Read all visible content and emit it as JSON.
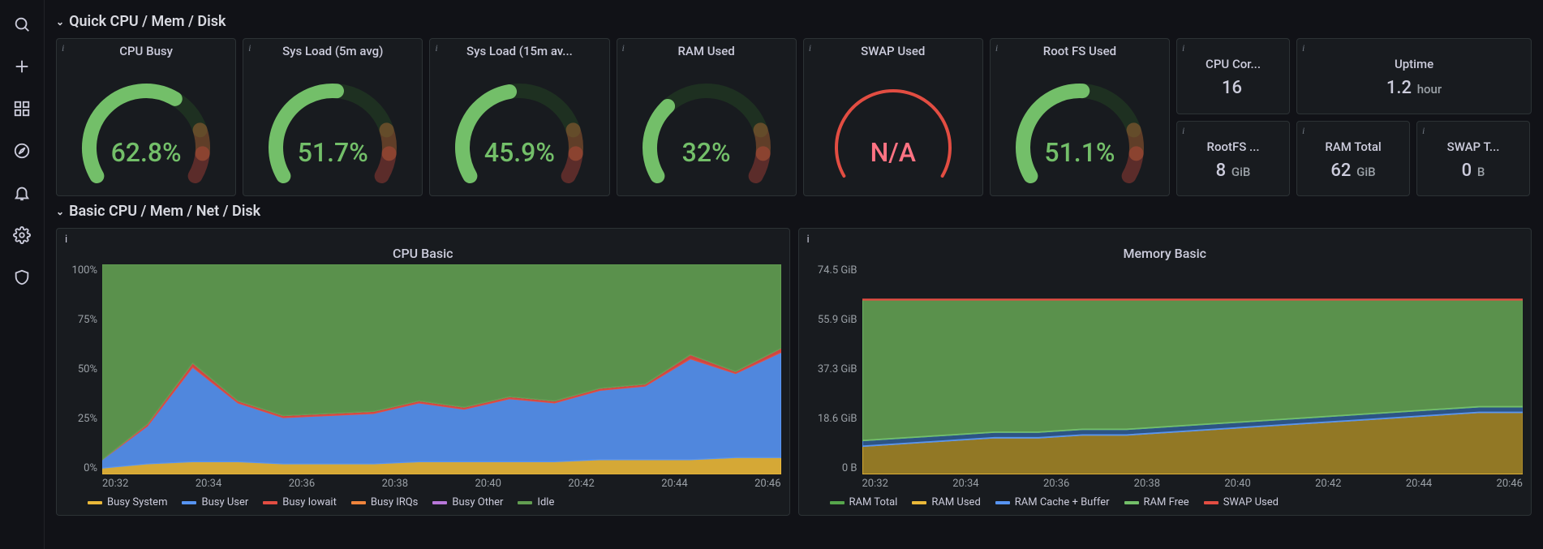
{
  "sidebar": {
    "items": [
      "search",
      "add",
      "dashboards",
      "explore",
      "alerting",
      "config",
      "admin"
    ]
  },
  "row1_title": "Quick CPU / Mem / Disk",
  "row2_title": "Basic CPU / Mem / Net / Disk",
  "gauges": [
    {
      "title": "CPU Busy",
      "value": 62.8,
      "display": "62.8%",
      "red": false
    },
    {
      "title": "Sys Load (5m avg)",
      "value": 51.7,
      "display": "51.7%",
      "red": false
    },
    {
      "title": "Sys Load (15m av...",
      "value": 45.9,
      "display": "45.9%",
      "red": false
    },
    {
      "title": "RAM Used",
      "value": 32,
      "display": "32%",
      "red": false
    },
    {
      "title": "SWAP Used",
      "value": null,
      "display": "N/A",
      "red": true
    },
    {
      "title": "Root FS Used",
      "value": 51.1,
      "display": "51.1%",
      "red": false
    }
  ],
  "stats_top": [
    {
      "title": "CPU Cor...",
      "value": "16",
      "unit": ""
    },
    {
      "title": "Uptime",
      "value": "1.2",
      "unit": "hour",
      "wide": true
    }
  ],
  "stats_bottom": [
    {
      "title": "RootFS ...",
      "value": "8",
      "unit": "GiB"
    },
    {
      "title": "RAM Total",
      "value": "62",
      "unit": "GiB"
    },
    {
      "title": "SWAP T...",
      "value": "0",
      "unit": "B"
    }
  ],
  "chart_data": [
    {
      "type": "area",
      "title": "CPU Basic",
      "xlabel": "",
      "ylabel": "",
      "ylim": [
        0,
        100
      ],
      "y_ticks": [
        "100%",
        "75%",
        "50%",
        "25%",
        "0%"
      ],
      "x_ticks": [
        "20:32",
        "20:34",
        "20:36",
        "20:38",
        "20:40",
        "20:42",
        "20:44",
        "20:46"
      ],
      "x": [
        "20:31",
        "20:32",
        "20:33",
        "20:34",
        "20:35",
        "20:36",
        "20:37",
        "20:38",
        "20:39",
        "20:40",
        "20:41",
        "20:42",
        "20:43",
        "20:44",
        "20:45",
        "20:46"
      ],
      "series": [
        {
          "name": "Busy System",
          "color": "#eab839",
          "values": [
            3,
            5,
            6,
            6,
            5,
            5,
            5,
            6,
            6,
            6,
            6,
            7,
            7,
            7,
            8,
            8
          ]
        },
        {
          "name": "Busy User",
          "color": "#5794f2",
          "values": [
            4,
            18,
            45,
            28,
            22,
            23,
            24,
            28,
            25,
            30,
            28,
            33,
            35,
            48,
            40,
            50
          ]
        },
        {
          "name": "Busy Iowait",
          "color": "#e24d42",
          "values": [
            0,
            1,
            2,
            1,
            1,
            1,
            1,
            1,
            1,
            1,
            1,
            1,
            1,
            2,
            1,
            2
          ]
        },
        {
          "name": "Busy IRQs",
          "color": "#ef843c",
          "values": [
            0,
            0,
            0,
            0,
            0,
            0,
            0,
            0,
            0,
            0,
            0,
            0,
            0,
            0,
            0,
            0
          ]
        },
        {
          "name": "Busy Other",
          "color": "#b877d9",
          "values": [
            0,
            0,
            0,
            0,
            0,
            0,
            0,
            0,
            0,
            0,
            0,
            0,
            0,
            0,
            0,
            0
          ]
        },
        {
          "name": "Idle",
          "color": "#629e51",
          "values": [
            93,
            76,
            47,
            65,
            72,
            71,
            70,
            65,
            68,
            63,
            65,
            59,
            57,
            43,
            51,
            40
          ]
        }
      ],
      "legend_anchor": "bottom"
    },
    {
      "type": "area",
      "title": "Memory Basic",
      "xlabel": "",
      "ylabel": "",
      "ylim": [
        0,
        74.5
      ],
      "y_ticks": [
        "74.5 GiB",
        "55.9 GiB",
        "37.3 GiB",
        "18.6 GiB",
        "0 B"
      ],
      "x_ticks": [
        "20:32",
        "20:34",
        "20:36",
        "20:38",
        "20:40",
        "20:42",
        "20:44",
        "20:46"
      ],
      "x": [
        "20:31",
        "20:32",
        "20:33",
        "20:34",
        "20:35",
        "20:36",
        "20:37",
        "20:38",
        "20:39",
        "20:40",
        "20:41",
        "20:42",
        "20:43",
        "20:44",
        "20:45",
        "20:46"
      ],
      "series": [
        {
          "name": "RAM Total",
          "color": "#56a64b",
          "values": [
            62,
            62,
            62,
            62,
            62,
            62,
            62,
            62,
            62,
            62,
            62,
            62,
            62,
            62,
            62,
            62
          ]
        },
        {
          "name": "RAM Used",
          "color": "#eab839",
          "values": [
            10,
            11,
            12,
            13,
            13,
            14,
            14,
            15,
            16,
            17,
            18,
            19,
            20,
            21,
            22,
            22
          ]
        },
        {
          "name": "RAM Cache + Buffer",
          "color": "#5794f2",
          "values": [
            2,
            2,
            2,
            2,
            2,
            2,
            2,
            2,
            2,
            2,
            2,
            2,
            2,
            2,
            2,
            2
          ]
        },
        {
          "name": "RAM Free",
          "color": "#73bf69",
          "values": [
            50,
            49,
            48,
            47,
            47,
            46,
            46,
            45,
            44,
            43,
            42,
            41,
            40,
            39,
            38,
            38
          ]
        },
        {
          "name": "SWAP Used",
          "color": "#e24d42",
          "values": [
            0,
            0,
            0,
            0,
            0,
            0,
            0,
            0,
            0,
            0,
            0,
            0,
            0,
            0,
            0,
            0
          ]
        }
      ],
      "legend_anchor": "bottom"
    }
  ]
}
